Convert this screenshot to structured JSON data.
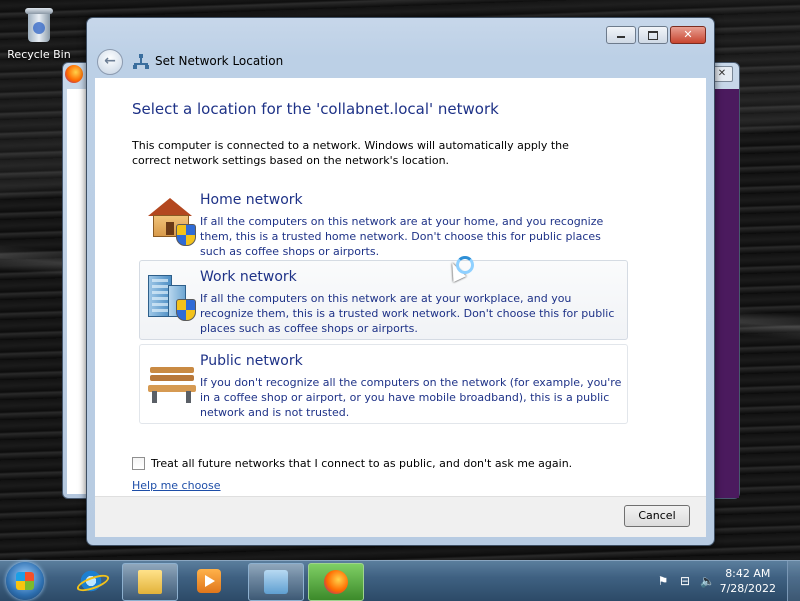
{
  "desktop": {
    "recycle_bin_label": "Recycle Bin"
  },
  "dialog": {
    "title": "Set Network Location",
    "heading": "Select a location for the 'collabnet.local' network",
    "intro": "This computer is connected to a network. Windows will automatically apply the correct network settings based on the network's location.",
    "options": [
      {
        "title": "Home network",
        "description": "If all the computers on this network are at your home, and you recognize them, this is a trusted home network.  Don't choose this for public places such as coffee shops or airports.",
        "icon": "house-shield-icon"
      },
      {
        "title": "Work network",
        "description": "If all the computers on this network are at your workplace, and you recognize them, this is a trusted work network.  Don't choose this for public places such as coffee shops or airports.",
        "icon": "building-shield-icon"
      },
      {
        "title": "Public network",
        "description": "If you don't recognize all the computers on the network (for example, you're in a coffee shop or airport, or you have mobile broadband), this is a public network and is not trusted.",
        "icon": "park-bench-icon"
      }
    ],
    "checkbox_label": "Treat all future networks that I connect to as public, and don't ask me again.",
    "checkbox_checked": false,
    "help_link": "Help me choose",
    "cancel_label": "Cancel",
    "back_glyph": "←",
    "close_glyph": "✕"
  },
  "background_window": {
    "close_glyph": "✕"
  },
  "taskbar": {
    "clock_time": "8:42 AM",
    "clock_date": "7/28/2022",
    "tray_icons": [
      "flag-icon",
      "network-icon",
      "volume-icon"
    ],
    "tray_glyphs": [
      "⚑",
      "⊟",
      "🔈"
    ],
    "pinned": [
      "internet-explorer-icon",
      "windows-explorer-icon",
      "media-player-icon",
      "network-control-panel-icon",
      "firefox-icon"
    ]
  },
  "colors": {
    "accent_blue": "#1e3287",
    "link_blue": "#1e4ea8",
    "taskbar": "#3f6182"
  }
}
